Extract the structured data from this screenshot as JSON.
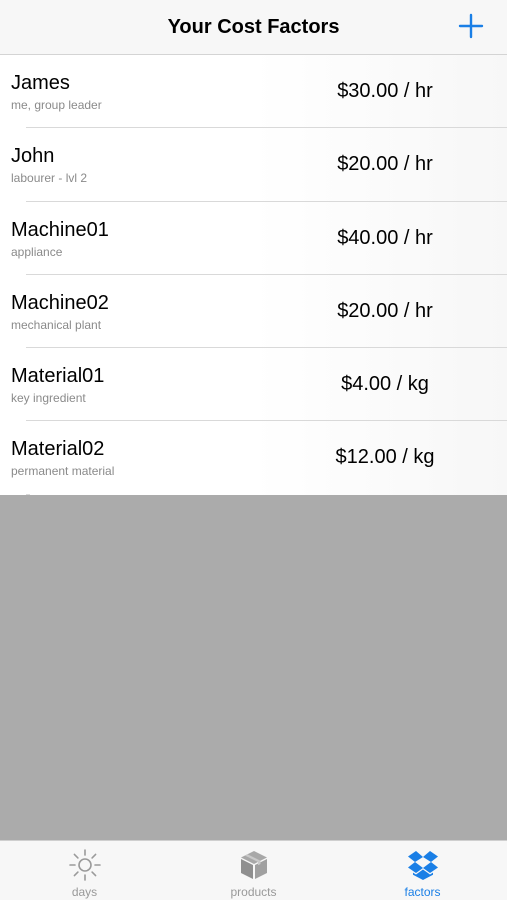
{
  "navbar": {
    "title": "Your Cost Factors"
  },
  "factors": [
    {
      "name": "James",
      "subtitle": "me, group leader",
      "rate": "$30.00 / hr"
    },
    {
      "name": "John",
      "subtitle": "labourer - lvl 2",
      "rate": "$20.00 / hr"
    },
    {
      "name": "Machine01",
      "subtitle": "appliance",
      "rate": "$40.00 / hr"
    },
    {
      "name": "Machine02",
      "subtitle": "mechanical plant",
      "rate": "$20.00 / hr"
    },
    {
      "name": "Material01",
      "subtitle": "key ingredient",
      "rate": "$4.00 / kg"
    },
    {
      "name": "Material02",
      "subtitle": "permanent material",
      "rate": "$12.00 / kg"
    }
  ],
  "tabbar": {
    "tabs": [
      {
        "label": "days",
        "icon": "sun-icon"
      },
      {
        "label": "products",
        "icon": "box-icon"
      },
      {
        "label": "factors",
        "icon": "dropbox-icon"
      }
    ],
    "active": "factors"
  },
  "colors": {
    "accent": "#1a7fe6",
    "inactive": "#999999",
    "empty_area": "#ababab"
  }
}
